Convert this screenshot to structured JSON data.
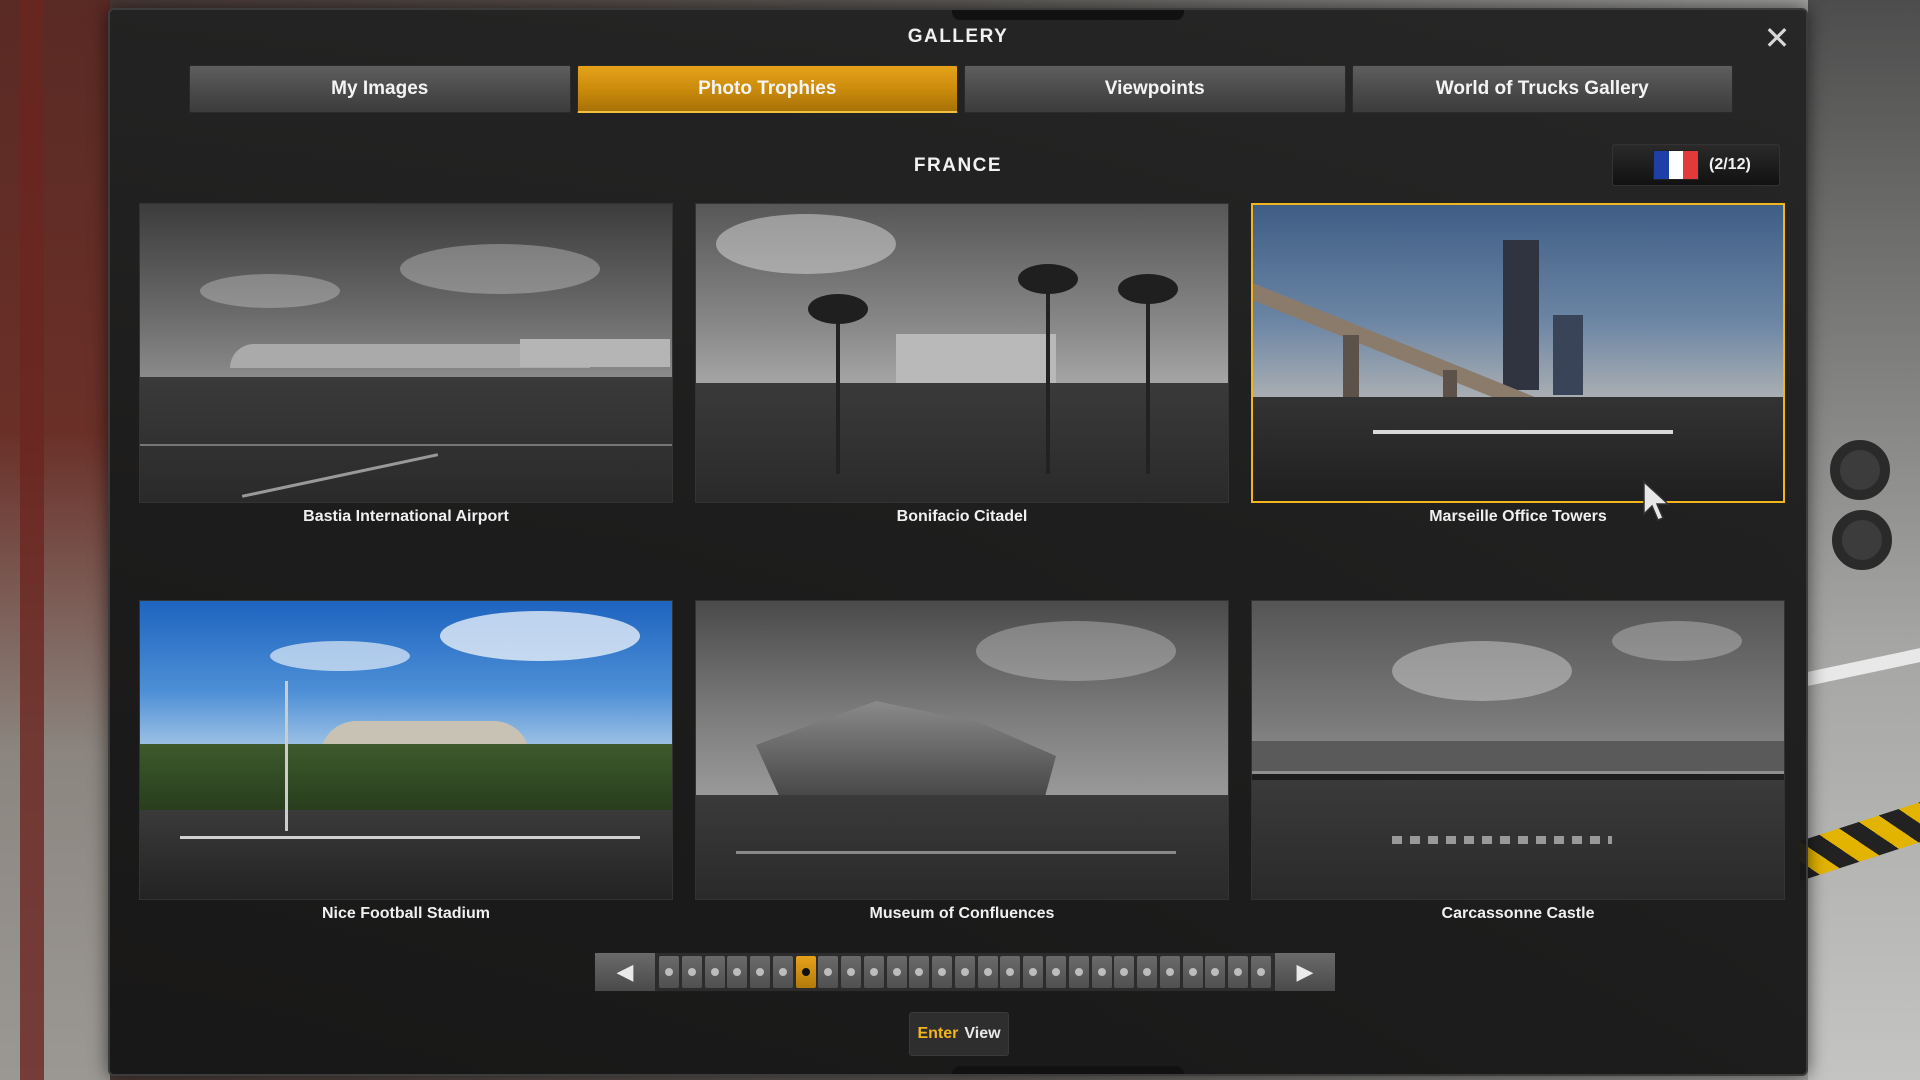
{
  "window": {
    "title": "GALLERY",
    "close_label": "✕"
  },
  "tabs": [
    {
      "label": "My Images",
      "active": false
    },
    {
      "label": "Photo Trophies",
      "active": true
    },
    {
      "label": "Viewpoints",
      "active": false
    },
    {
      "label": "World of Trucks Gallery",
      "active": false
    }
  ],
  "region": {
    "name": "FRANCE",
    "counter": "(2/12)",
    "flag_colors": [
      "#1f3fa8",
      "#ffffff",
      "#e23a3a"
    ]
  },
  "photos": [
    {
      "label": "Bastia International Airport",
      "selected": false,
      "style": "grayscale"
    },
    {
      "label": "Bonifacio Citadel",
      "selected": false,
      "style": "grayscale"
    },
    {
      "label": "Marseille Office Towers",
      "selected": true,
      "style": "color"
    },
    {
      "label": "Nice Football Stadium",
      "selected": false,
      "style": "color"
    },
    {
      "label": "Museum of Confluences",
      "selected": false,
      "style": "grayscale"
    },
    {
      "label": "Carcassonne Castle",
      "selected": false,
      "style": "grayscale"
    }
  ],
  "pager": {
    "prev_icon": "chevron-left-icon",
    "next_icon": "chevron-right-icon",
    "total_pages": 27,
    "current_page_index": 6
  },
  "hint": {
    "key": "Enter",
    "action": "View"
  },
  "colors": {
    "accent": "#e6a21a",
    "selection_border": "#f2b51e"
  }
}
